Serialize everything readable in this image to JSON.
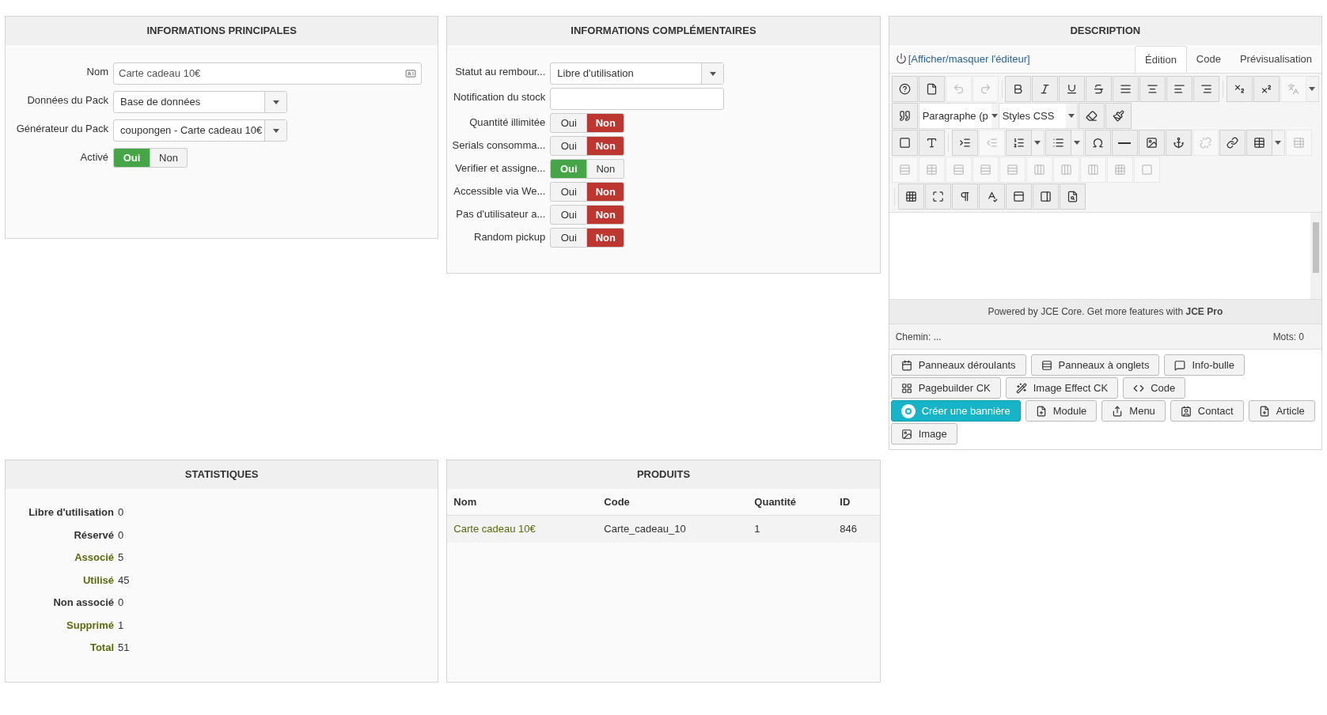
{
  "main_info": {
    "title": "INFORMATIONS PRINCIPALES",
    "fields": [
      {
        "kind": "text",
        "label": "Nom",
        "value": "Carte cadeau 10€"
      },
      {
        "kind": "select",
        "label": "Données du Pack",
        "value": "Base de données"
      },
      {
        "kind": "select",
        "label": "Générateur du Pack",
        "value": "coupongen - Carte cadeau 10€"
      },
      {
        "kind": "toggle",
        "label": "Activé",
        "options": [
          {
            "label": "Oui",
            "selected": true
          },
          {
            "label": "Non",
            "selected": false
          }
        ]
      }
    ]
  },
  "extra_info": {
    "title": "INFORMATIONS COMPLÉMENTAIRES",
    "fields": [
      {
        "kind": "select",
        "label": "Statut au rembour...",
        "value": "Libre d'utilisation"
      },
      {
        "kind": "text",
        "label": "Notification du stock"
      },
      {
        "kind": "toggle",
        "label": "Quantité illimitée",
        "options": [
          {
            "label": "Oui",
            "selected": false
          },
          {
            "label": "Non",
            "selected": true
          }
        ]
      },
      {
        "kind": "toggle",
        "label": "Serials consomma...",
        "options": [
          {
            "label": "Oui",
            "selected": false
          },
          {
            "label": "Non",
            "selected": true
          }
        ]
      },
      {
        "kind": "toggle",
        "label": "Verifier et assigne...",
        "options": [
          {
            "label": "Oui",
            "selected": true
          },
          {
            "label": "Non",
            "selected": false
          }
        ]
      },
      {
        "kind": "toggle",
        "label": "Accessible via We...",
        "options": [
          {
            "label": "Oui",
            "selected": false
          },
          {
            "label": "Non",
            "selected": true
          }
        ]
      },
      {
        "kind": "toggle",
        "label": "Pas d'utilisateur a...",
        "options": [
          {
            "label": "Oui",
            "selected": false
          },
          {
            "label": "Non",
            "selected": true
          }
        ]
      },
      {
        "kind": "toggle",
        "label": "Random pickup",
        "options": [
          {
            "label": "Oui",
            "selected": false
          },
          {
            "label": "Non",
            "selected": true
          }
        ]
      }
    ]
  },
  "description": {
    "title": "DESCRIPTION",
    "toggle_link": "[Afficher/masquer l'éditeur]",
    "tabs": [
      {
        "label": "Édition",
        "selected": true
      },
      {
        "label": "Code",
        "selected": false
      },
      {
        "label": "Prévisualisation",
        "selected": false
      }
    ],
    "toolbar": [
      [
        {
          "disabled": false
        },
        {
          "disabled": false
        },
        {
          "disabled": true
        },
        {
          "disabled": true
        },
        {
          "disabled": false
        },
        {
          "disabled": false
        },
        {
          "disabled": false
        },
        {
          "disabled": false
        },
        {
          "disabled": false
        },
        {
          "disabled": false
        },
        {
          "disabled": false
        },
        {
          "disabled": false
        },
        {
          "disabled": false
        },
        {
          "disabled": false
        },
        {
          "disabled": true
        }
      ],
      [
        {
          "disabled": false
        },
        {
          "disabled": false
        },
        {
          "disabled": false
        }
      ],
      [
        {
          "disabled": false
        },
        {
          "disabled": false
        },
        {
          "disabled": false
        },
        {
          "disabled": true
        },
        {
          "disabled": false
        },
        {
          "disabled": false
        },
        {
          "disabled": false
        },
        {
          "disabled": false
        },
        {
          "disabled": false
        },
        {
          "disabled": false
        },
        {
          "disabled": true
        },
        {
          "disabled": false
        },
        {
          "disabled": false
        },
        {
          "disabled": true
        }
      ],
      [
        {
          "disabled": true
        },
        {
          "disabled": true
        },
        {
          "disabled": true
        },
        {
          "disabled": true
        },
        {
          "disabled": true
        },
        {
          "disabled": true
        },
        {
          "disabled": true
        },
        {
          "disabled": true
        },
        {
          "disabled": true
        },
        {
          "disabled": true
        }
      ],
      [
        {
          "disabled": false
        },
        {
          "disabled": false
        },
        {
          "disabled": false
        },
        {
          "disabled": false
        },
        {
          "disabled": false
        },
        {
          "disabled": false
        },
        {
          "disabled": false
        }
      ]
    ],
    "format_select": "Paragraphe (p",
    "styles_select": "Styles CSS",
    "powered": "Powered by JCE Core. Get more features with **JCE Pro**",
    "path": "Chemin: ...",
    "words": "Mots: 0",
    "buttons": [
      {
        "label": "Panneaux déroulants",
        "kind": "default"
      },
      {
        "label": "Panneaux à onglets",
        "kind": "default"
      },
      {
        "label": "Info-bulle",
        "kind": "default"
      },
      {
        "label": "Pagebuilder CK",
        "kind": "default"
      },
      {
        "label": "Image Effect CK",
        "kind": "default"
      },
      {
        "label": "Code",
        "kind": "default"
      },
      {
        "label": "Créer une bannière",
        "kind": "primary"
      },
      {
        "label": "Module",
        "kind": "default"
      },
      {
        "label": "Menu",
        "kind": "default"
      },
      {
        "label": "Contact",
        "kind": "default"
      },
      {
        "label": "Article",
        "kind": "default"
      },
      {
        "label": "Image",
        "kind": "default"
      }
    ]
  },
  "statistics": {
    "title": "STATISTIQUES",
    "rows": [
      {
        "label": "Libre d'utilisation",
        "value": "0",
        "linked": false
      },
      {
        "label": "Réservé",
        "value": "0",
        "linked": false
      },
      {
        "label": "Associé",
        "value": "5",
        "linked": true
      },
      {
        "label": "Utilisé",
        "value": "45",
        "linked": true
      },
      {
        "label": "Non associé",
        "value": "0",
        "linked": false
      },
      {
        "label": "Supprimé",
        "value": "1",
        "linked": true
      },
      {
        "label": "Total",
        "value": "51",
        "linked": true
      }
    ]
  },
  "products": {
    "title": "PRODUITS",
    "columns": [
      "Nom",
      "Code",
      "Quantité",
      "ID"
    ],
    "rows": [
      [
        "Carte cadeau 10€",
        "Carte_cadeau_10",
        "1",
        "846"
      ]
    ]
  }
}
